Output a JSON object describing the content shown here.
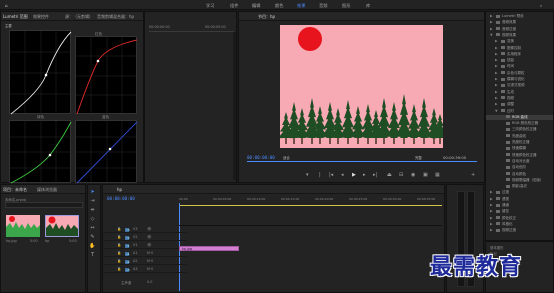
{
  "workspaces": [
    "学习",
    "组件",
    "编辑",
    "颜色",
    "效果",
    "音频",
    "图形",
    "库"
  ],
  "active_workspace": "效果",
  "scopes": {
    "tabs": [
      "Lumetri 范围",
      "效果控件",
      "源：（无剪辑）",
      "音频剪辑混合器：hp"
    ],
    "curve_labels": [
      "主要",
      "红色",
      "绿色",
      "蓝色"
    ],
    "timecode_start": "00:00:00:00",
    "timecode_end": "00:00:05:00"
  },
  "program": {
    "tab": "节目：hp",
    "timecode": "00:00:00:00",
    "zoom": "适合",
    "quality": "完整",
    "duration": "00:00:39:00",
    "colors": {
      "background": "#f7a9b4",
      "sun": "#e8141d",
      "tree": "#1f4d24"
    }
  },
  "effects_tree": [
    {
      "label": "Lumetri 预设",
      "arrow": "▶",
      "sel": false
    },
    {
      "label": "音频效果",
      "arrow": "▶",
      "sel": false
    },
    {
      "label": "音频过渡",
      "arrow": "▶",
      "sel": false
    },
    {
      "label": "视频效果",
      "arrow": "▼",
      "sel": false
    },
    {
      "label": "变换",
      "arrow": "▶",
      "sel": false
    },
    {
      "label": "图像控制",
      "arrow": "▶",
      "sel": false
    },
    {
      "label": "实用程序",
      "arrow": "▶",
      "sel": false
    },
    {
      "label": "扭曲",
      "arrow": "▶",
      "sel": false
    },
    {
      "label": "时间",
      "arrow": "▶",
      "sel": false
    },
    {
      "label": "杂色与颗粒",
      "arrow": "▶",
      "sel": false
    },
    {
      "label": "模糊与锐化",
      "arrow": "▶",
      "sel": false
    },
    {
      "label": "沉浸式视频",
      "arrow": "▶",
      "sel": false
    },
    {
      "label": "生成",
      "arrow": "▶",
      "sel": false
    },
    {
      "label": "视频",
      "arrow": "▶",
      "sel": false
    },
    {
      "label": "调整",
      "arrow": "▶",
      "sel": false
    },
    {
      "label": "过时",
      "arrow": "▼",
      "sel": false
    },
    {
      "label": "RGB 曲线",
      "arrow": "",
      "sel": true
    },
    {
      "label": "RGB 颜色校正器",
      "arrow": "",
      "sel": false
    },
    {
      "label": "三向颜色校正器",
      "arrow": "",
      "sel": false
    },
    {
      "label": "亮度曲线",
      "arrow": "",
      "sel": false
    },
    {
      "label": "亮度校正器",
      "arrow": "",
      "sel": false
    },
    {
      "label": "快速模糊",
      "arrow": "",
      "sel": false
    },
    {
      "label": "快速颜色校正器",
      "arrow": "",
      "sel": false
    },
    {
      "label": "自动对比度",
      "arrow": "",
      "sel": false
    },
    {
      "label": "自动色阶",
      "arrow": "",
      "sel": false
    },
    {
      "label": "自动颜色",
      "arrow": "",
      "sel": false
    },
    {
      "label": "视频限幅器（旧版）",
      "arrow": "",
      "sel": false
    },
    {
      "label": "阴影/高光",
      "arrow": "",
      "sel": false
    },
    {
      "label": "过渡",
      "arrow": "▶",
      "sel": false
    },
    {
      "label": "透视",
      "arrow": "▶",
      "sel": false
    },
    {
      "label": "通道",
      "arrow": "▶",
      "sel": false
    },
    {
      "label": "键控",
      "arrow": "▶",
      "sel": false
    },
    {
      "label": "颜色校正",
      "arrow": "▶",
      "sel": false
    },
    {
      "label": "风格化",
      "arrow": "▶",
      "sel": false
    },
    {
      "label": "视频过渡",
      "arrow": "▶",
      "sel": false
    }
  ],
  "project": {
    "tabs": [
      "项目：未命名",
      "媒体浏览器"
    ],
    "path": "未命名.prproj",
    "items": [
      {
        "name": "hp.jpg",
        "duration": "5:00"
      },
      {
        "name": "hp",
        "duration": "5:00"
      }
    ]
  },
  "timeline": {
    "tab": "hp",
    "timecode": "00:00:00:00",
    "ruler": [
      "00:00",
      "00:00:05:00",
      "00:00:10:00",
      "00:00:15:00",
      "00:00:20:00",
      "00:00:25:00",
      "00:00:30:00",
      "00:00:35:00"
    ],
    "tracks": [
      "V3",
      "V2",
      "V1",
      "A1",
      "A2",
      "A3"
    ],
    "master": "主声道",
    "master_value": "0.0",
    "clip_label": "hp.jpg",
    "clip_color": "#d27fd2"
  },
  "extra_panel": {
    "title1": "基本图形",
    "title2": "标记"
  },
  "watermark": "最需教育"
}
